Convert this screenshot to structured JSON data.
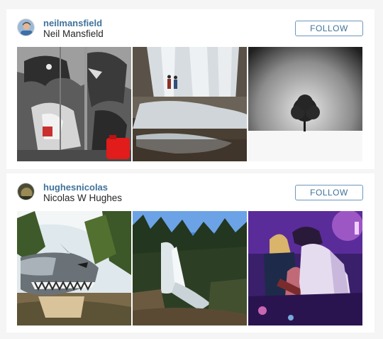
{
  "suggestions": [
    {
      "username": "neilmansfield",
      "full_name": "Neil Mansfield",
      "follow_label": "FOLLOW",
      "photos": [
        {
          "icon": "street-mural-photo"
        },
        {
          "icon": "waterfall-photo"
        },
        {
          "icon": "lone-tree-snow-photo"
        }
      ]
    },
    {
      "username": "hughesnicolas",
      "full_name": "Nicolas W Hughes",
      "follow_label": "FOLLOW",
      "photos": [
        {
          "icon": "wolf-sculpture-photo"
        },
        {
          "icon": "forest-waterfall-photo"
        },
        {
          "icon": "concert-band-photo"
        }
      ]
    }
  ],
  "colors": {
    "username": "#3f729b",
    "follow_border": "#6c97bf",
    "text": "#262626",
    "background": "#f5f5f5"
  }
}
